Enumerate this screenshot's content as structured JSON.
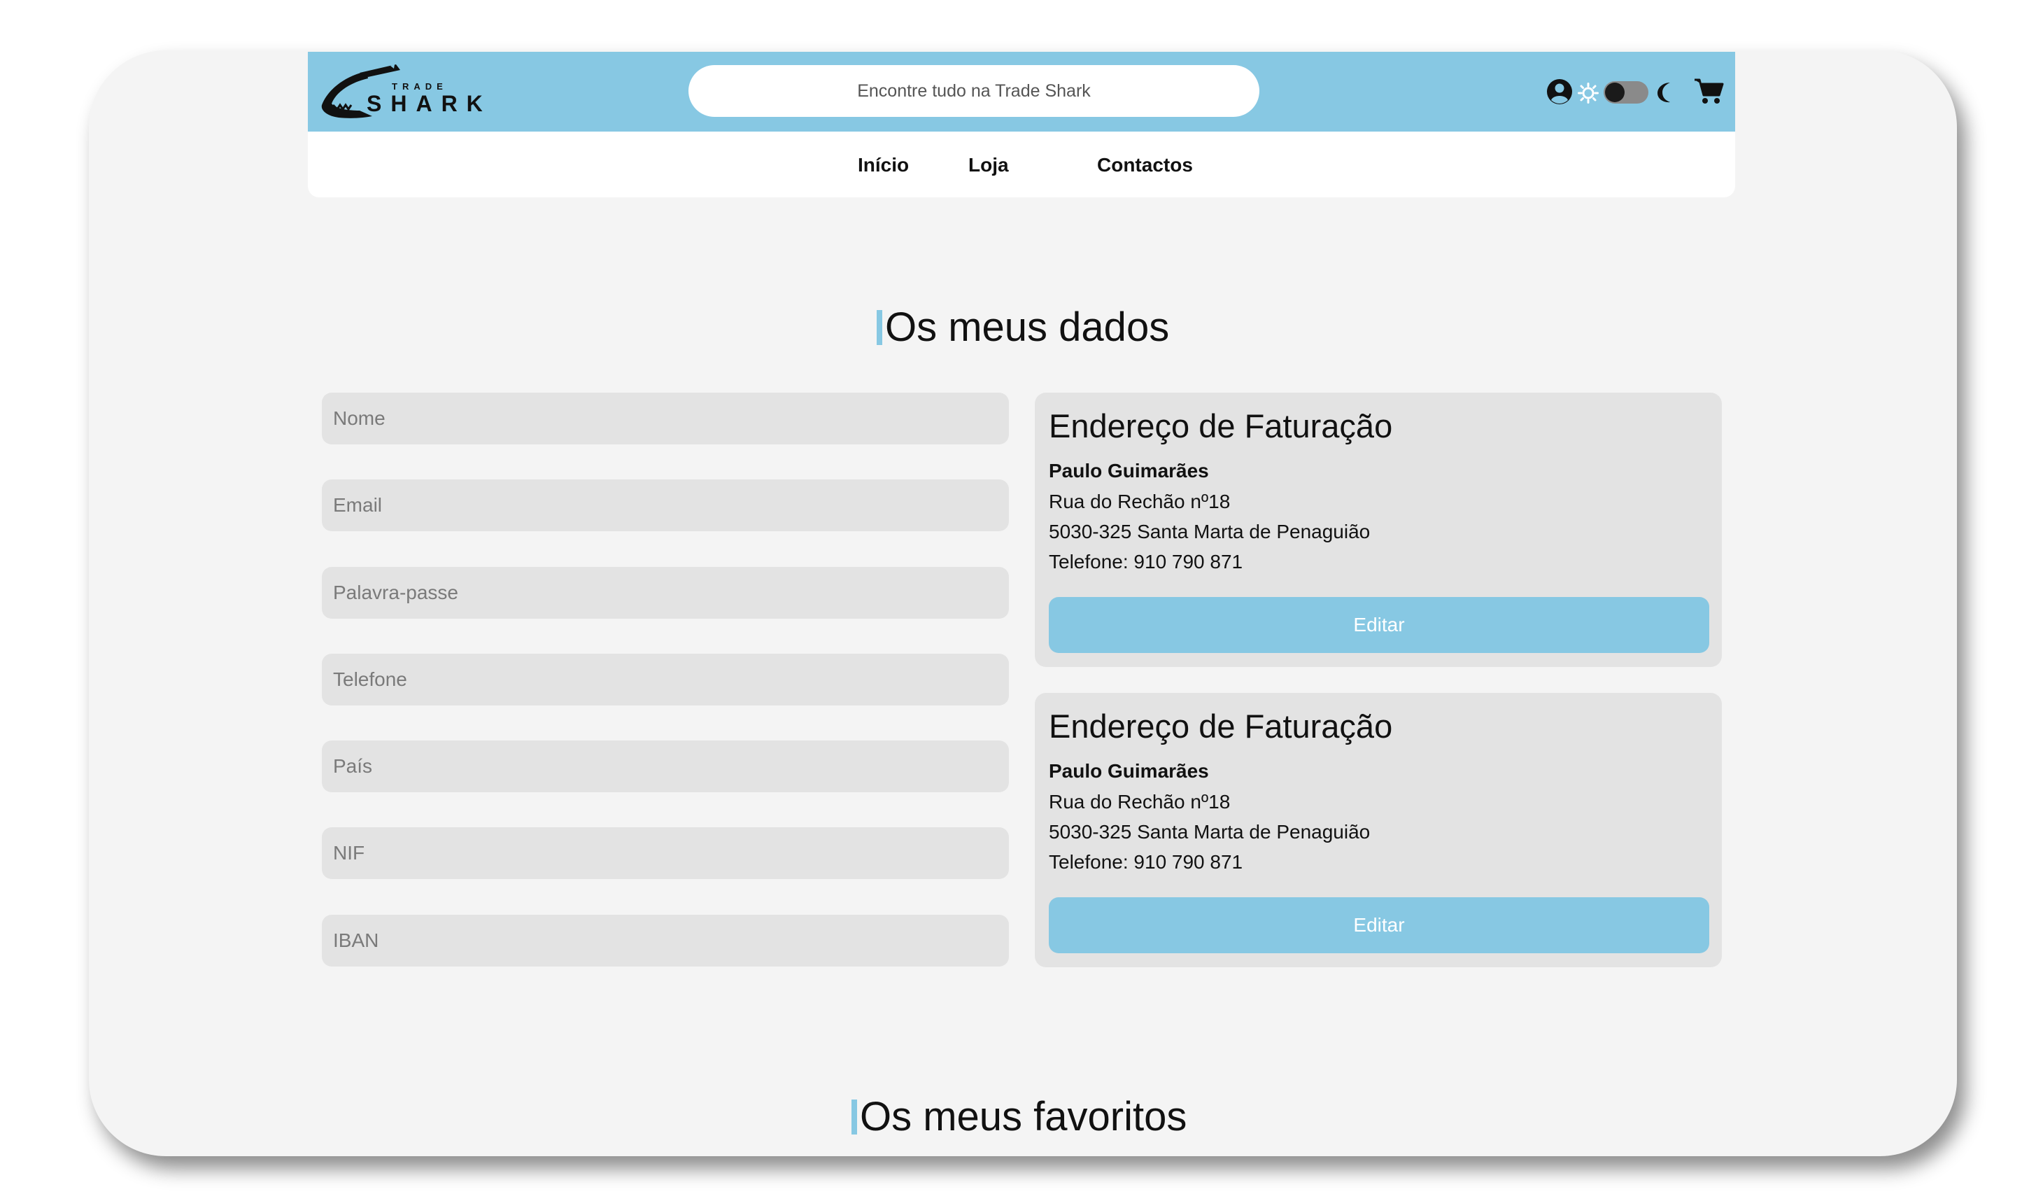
{
  "header": {
    "logo_top": "TRADE",
    "logo_bottom": "SHARK",
    "search_placeholder": "Encontre tudo na Trade Shark",
    "accent_color": "#87c8e3",
    "icons": [
      "account-icon",
      "sun-icon",
      "theme-toggle",
      "moon-icon",
      "cart-icon"
    ],
    "theme": "light"
  },
  "nav": {
    "items": [
      {
        "label": "Início"
      },
      {
        "label": "Loja"
      },
      {
        "label": "Contactos"
      }
    ]
  },
  "my_data": {
    "title": "Os meus dados",
    "fields": [
      {
        "placeholder": "Nome",
        "value": ""
      },
      {
        "placeholder": "Email",
        "value": ""
      },
      {
        "placeholder": "Palavra-passe",
        "value": ""
      },
      {
        "placeholder": "Telefone",
        "value": ""
      },
      {
        "placeholder": "País",
        "value": ""
      },
      {
        "placeholder": "NIF",
        "value": ""
      },
      {
        "placeholder": "IBAN",
        "value": ""
      }
    ],
    "addresses": [
      {
        "title": "Endereço de Faturação",
        "name": "Paulo Guimarães",
        "street": "Rua do Rechão nº18",
        "city": "5030-325 Santa Marta de Penaguião",
        "phone": "Telefone: 910 790 871",
        "button": "Editar"
      },
      {
        "title": "Endereço de Faturação",
        "name": "Paulo Guimarães",
        "street": "Rua do Rechão nº18",
        "city": "5030-325 Santa Marta de Penaguião",
        "phone": "Telefone: 910 790 871",
        "button": "Editar"
      }
    ]
  },
  "favorites": {
    "title": "Os meus favoritos"
  }
}
